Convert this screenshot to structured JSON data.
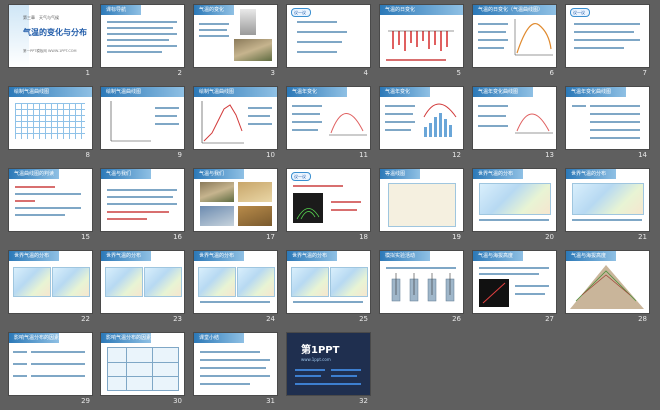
{
  "slides": [
    {
      "number": "1",
      "title": "气温的变化与分布",
      "kicker": "第三章　天气与气候",
      "footer": "第一PPT模板网 WWW.1PPT.COM"
    },
    {
      "number": "2",
      "header": "课标导航"
    },
    {
      "number": "3",
      "header": "气温的变化"
    },
    {
      "number": "4",
      "badge": "议一议"
    },
    {
      "number": "5",
      "header": "气温的日变化"
    },
    {
      "number": "6",
      "header": "气温的日变化（气温曲线图）"
    },
    {
      "number": "7",
      "badge": "议一议"
    },
    {
      "number": "8",
      "header": "绘制气温曲线图"
    },
    {
      "number": "9",
      "header": "绘制气温曲线图"
    },
    {
      "number": "10",
      "header": "绘制气温曲线图"
    },
    {
      "number": "11",
      "header": "气温年变化"
    },
    {
      "number": "12",
      "header": "气温年变化"
    },
    {
      "number": "13",
      "header": "气温年变化曲线图"
    },
    {
      "number": "14",
      "header": "气温年变化曲线图"
    },
    {
      "number": "15",
      "header": "气温曲线图的判读"
    },
    {
      "number": "16",
      "header": "气温与我们"
    },
    {
      "number": "17",
      "header": "气温与我们"
    },
    {
      "number": "18",
      "badge": "议一议"
    },
    {
      "number": "19",
      "header": "等温线图"
    },
    {
      "number": "20",
      "header": "世界气温的分布"
    },
    {
      "number": "21",
      "header": "世界气温的分布"
    },
    {
      "number": "22",
      "header": "世界气温的分布"
    },
    {
      "number": "23",
      "header": "世界气温的分布"
    },
    {
      "number": "24",
      "header": "世界气温的分布"
    },
    {
      "number": "25",
      "header": "世界气温的分布"
    },
    {
      "number": "26",
      "header": "模拟实验活动"
    },
    {
      "number": "27",
      "header": "气温与海拔高度"
    },
    {
      "number": "28",
      "header": "气温与海拔高度"
    },
    {
      "number": "29",
      "header": "影响气温分布的因素"
    },
    {
      "number": "30",
      "header": "影响气温分布的因素"
    },
    {
      "number": "31",
      "header": "课堂小结"
    },
    {
      "number": "32",
      "logo_text": "第1PPT",
      "logo_sub": "www.1ppt.com"
    }
  ]
}
